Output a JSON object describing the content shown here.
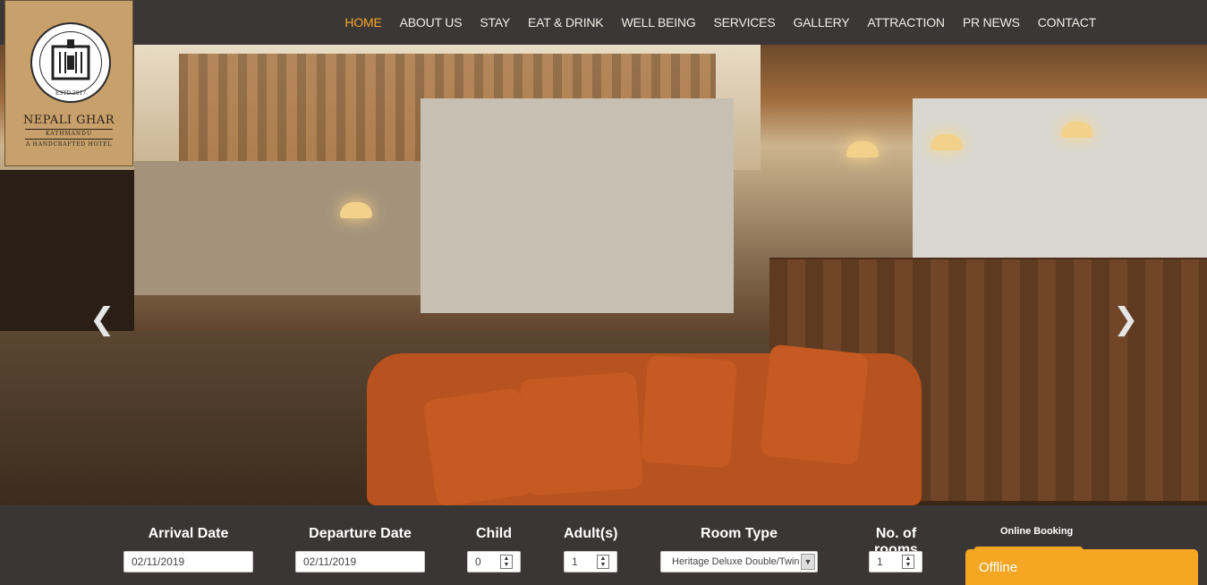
{
  "brand": {
    "name": "NEPALI GHAR",
    "city": "KATHMANDU",
    "tagline": "A HANDCRAFTED HOTEL",
    "est": "ESTD.2017",
    "bg_color": "#c7a06b"
  },
  "nav": {
    "items": [
      {
        "label": "HOME",
        "active": true
      },
      {
        "label": "ABOUT US",
        "active": false
      },
      {
        "label": "STAY",
        "active": false
      },
      {
        "label": "EAT & DRINK",
        "active": false
      },
      {
        "label": "WELL BEING",
        "active": false
      },
      {
        "label": "SERVICES",
        "active": false
      },
      {
        "label": "GALLERY",
        "active": false
      },
      {
        "label": "ATTRACTION",
        "active": false
      },
      {
        "label": "PR NEWS",
        "active": false
      },
      {
        "label": "CONTACT",
        "active": false
      }
    ],
    "active_color": "#f5a623"
  },
  "slider": {
    "prev_icon": "chevron-left-icon",
    "next_icon": "chevron-right-icon",
    "prev_glyph": "❮",
    "next_glyph": "❯"
  },
  "booking": {
    "arrival_label": "Arrival Date",
    "arrival_value": "02/11/2019",
    "departure_label": "Departure Date",
    "departure_value": "02/11/2019",
    "child_label": "Child",
    "child_value": "0",
    "adults_label": "Adult(s)",
    "adults_value": "1",
    "room_type_label": "Room Type",
    "room_type_value": "Heritage Deluxe Double/Twin",
    "rooms_label": "No. of rooms",
    "rooms_value": "1",
    "online_booking": "Online Booking"
  },
  "chat": {
    "status": "Offline",
    "color": "#f5a623"
  }
}
